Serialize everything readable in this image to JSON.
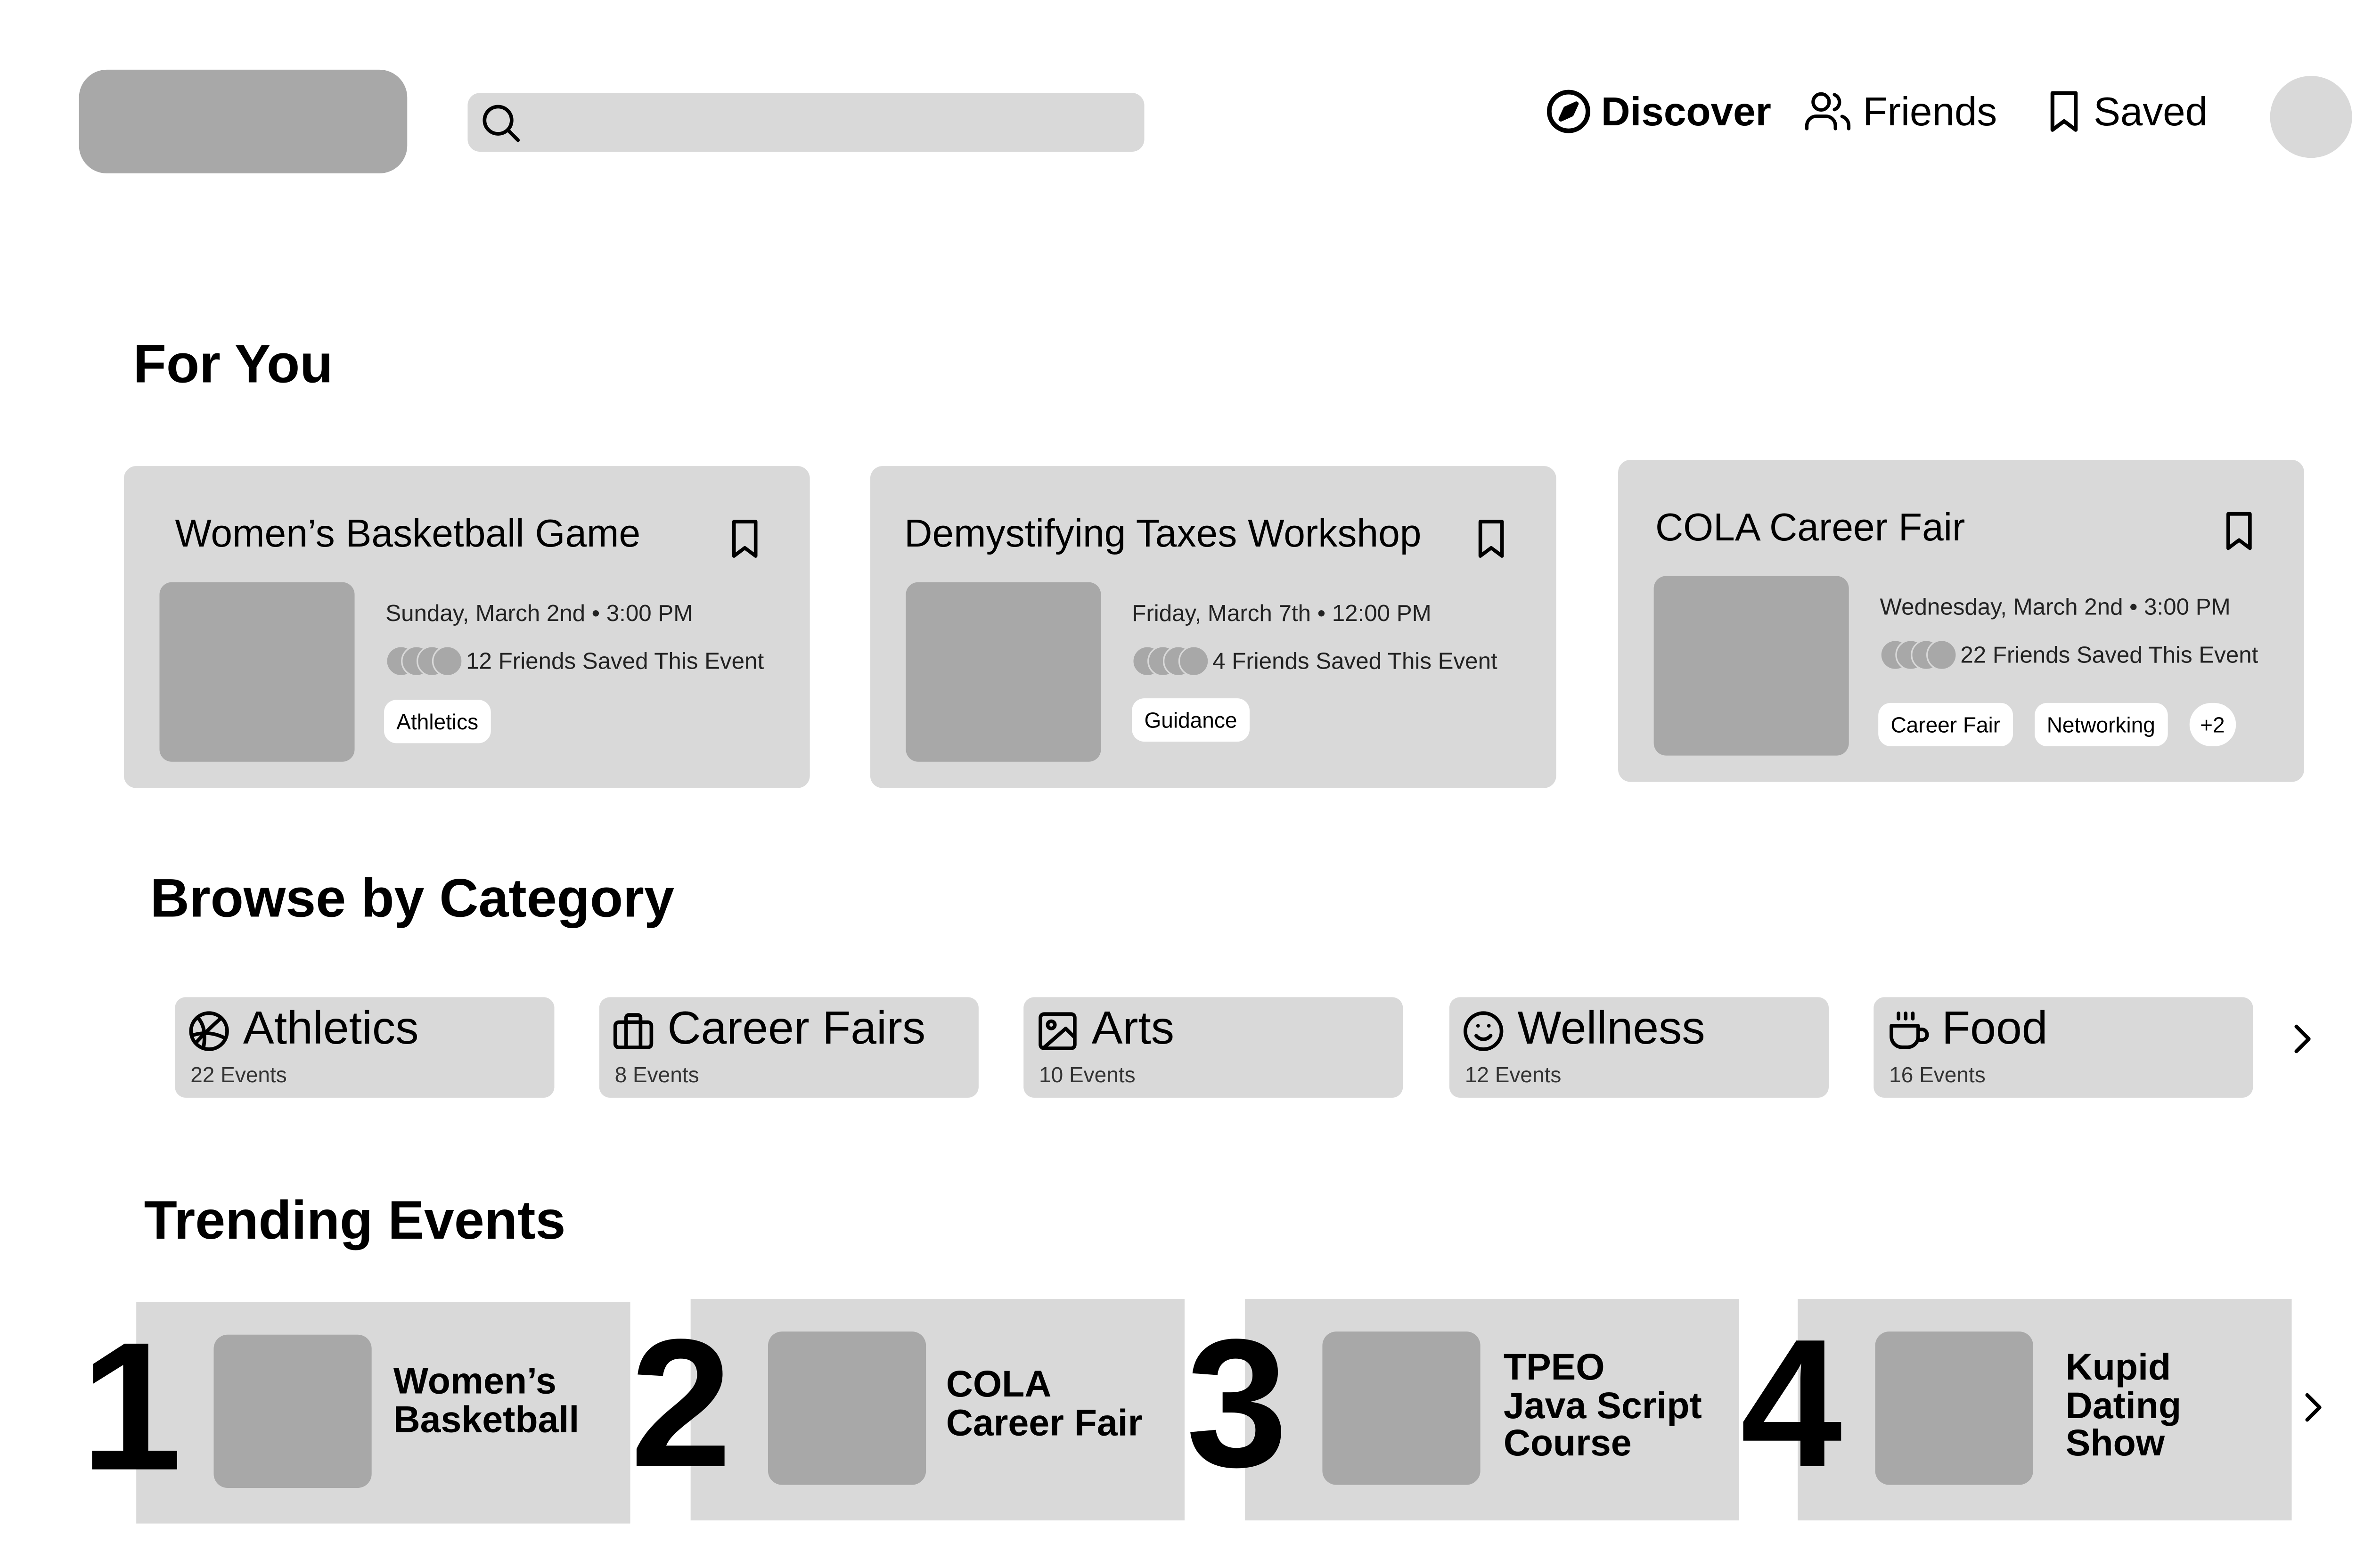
{
  "header": {
    "search": {
      "placeholder": ""
    },
    "nav": [
      {
        "label": "Discover",
        "icon": "compass-icon",
        "active": true
      },
      {
        "label": "Friends",
        "icon": "users-icon",
        "active": false
      },
      {
        "label": "Saved",
        "icon": "bookmark-icon",
        "active": false
      }
    ]
  },
  "for_you": {
    "title": "For You",
    "cards": [
      {
        "title": "Women’s Basketball Game",
        "date": "Sunday, March 2nd • 3:00 PM",
        "friends": "12 Friends Saved This Event",
        "tags": [
          "Athletics"
        ]
      },
      {
        "title": "Demystifying Taxes Workshop",
        "date": "Friday, March 7th • 12:00 PM",
        "friends": "4 Friends Saved This Event",
        "tags": [
          "Guidance"
        ]
      },
      {
        "title": "COLA Career Fair",
        "date": "Wednesday, March 2nd • 3:00 PM",
        "friends": "22 Friends Saved This Event",
        "tags": [
          "Career Fair",
          "Networking"
        ],
        "more_tags": "+2"
      }
    ]
  },
  "browse": {
    "title": "Browse by Category",
    "categories": [
      {
        "name": "Athletics",
        "count": "22 Events",
        "icon": "basketball-icon"
      },
      {
        "name": "Career Fairs",
        "count": "8 Events",
        "icon": "briefcase-icon"
      },
      {
        "name": "Arts",
        "count": "10 Events",
        "icon": "image-icon"
      },
      {
        "name": "Wellness",
        "count": "12 Events",
        "icon": "smile-icon"
      },
      {
        "name": "Food",
        "count": "16 Events",
        "icon": "coffee-icon"
      }
    ]
  },
  "trending": {
    "title": "Trending Events",
    "items": [
      {
        "rank": "1",
        "lines": [
          "Women’s",
          "Basketball"
        ]
      },
      {
        "rank": "2",
        "lines": [
          "COLA",
          "Career Fair"
        ]
      },
      {
        "rank": "3",
        "lines": [
          "TPEO",
          "Java Script",
          "Course"
        ]
      },
      {
        "rank": "4",
        "lines": [
          "Kupid",
          "Dating",
          "Show"
        ]
      }
    ]
  },
  "colors": {
    "placeholder_dark": "#a8a8a8",
    "placeholder_light": "#d9d9d9",
    "background": "#ffffff",
    "text": "#000000"
  }
}
